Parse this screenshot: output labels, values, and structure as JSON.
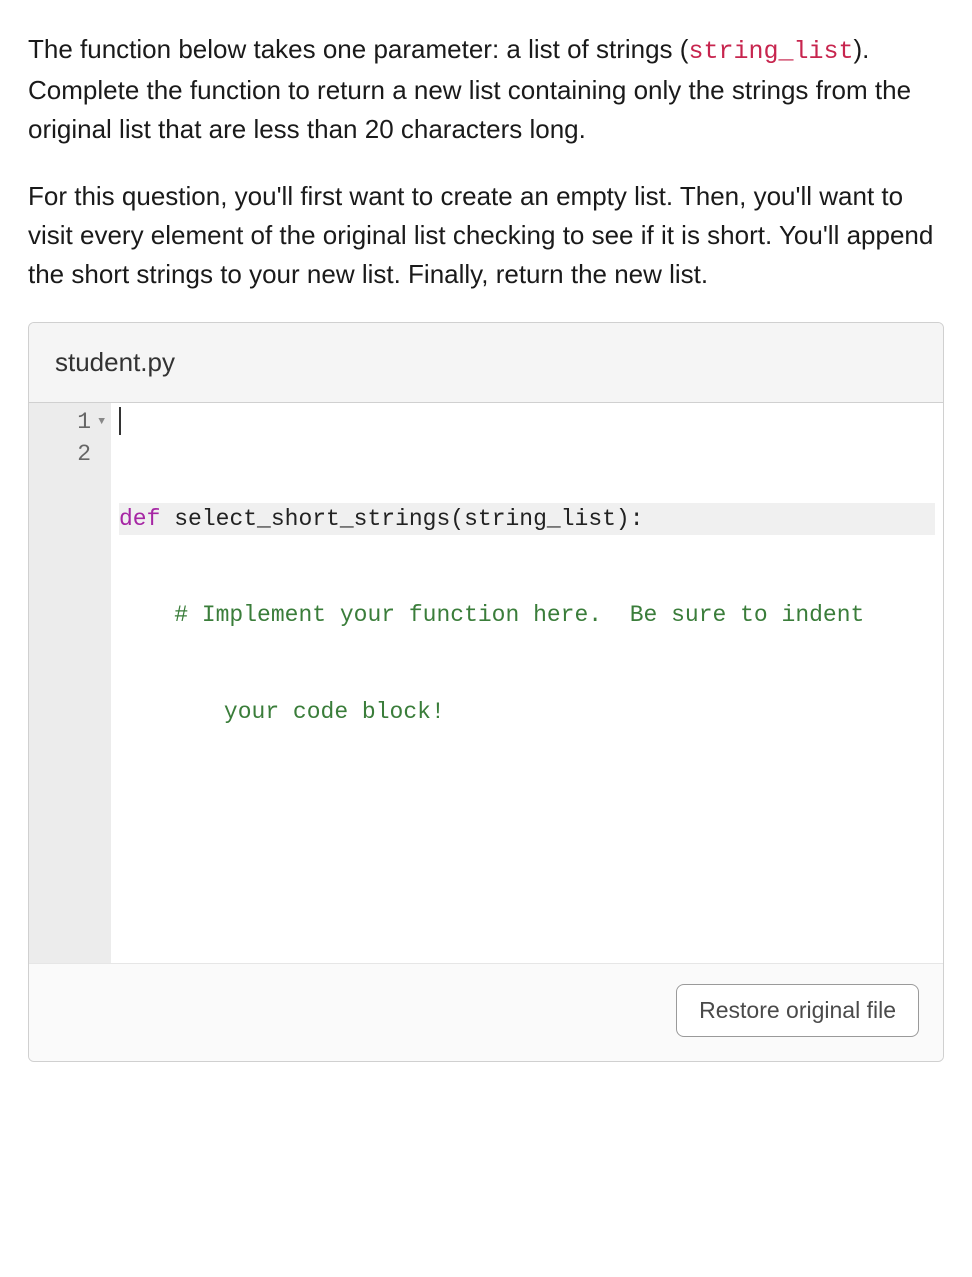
{
  "description": {
    "para1_prefix": "The function below takes one parameter: a list of strings (",
    "para1_code": "string_list",
    "para1_suffix": "). Complete the function to return a new list containing only the strings from the original list that are less than 20 characters long.",
    "para2": "For this question, you'll first want to create an empty list. Then, you'll want to visit every element of the original list checking to see if it is short. You'll append the short strings to your new list. Finally, return the new list."
  },
  "editor": {
    "filename": "student.py",
    "gutter": {
      "line1": "1",
      "line2": "2"
    },
    "code": {
      "l1_keyword": "def",
      "l1_space1": " ",
      "l1_func": "select_short_strings",
      "l1_open": "(",
      "l1_arg": "string_list",
      "l1_close": "):",
      "l2_indent": "    ",
      "l2_comment_a": "# Implement your function here.  Be sure to indent",
      "l2_comment_b": "your code block!"
    },
    "restore_label": "Restore original file"
  }
}
